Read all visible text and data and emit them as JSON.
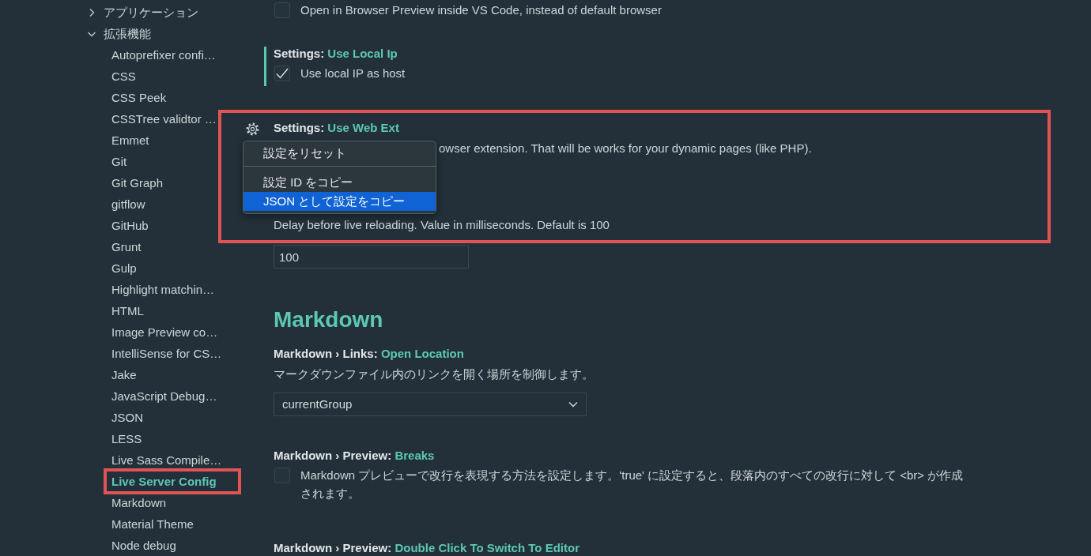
{
  "sidebar": {
    "items": [
      {
        "label": "アプリケーション",
        "expanded": false
      },
      {
        "label": "拡張機能",
        "expanded": true,
        "children": [
          {
            "label": "Autoprefixer confi…",
            "selected": false,
            "highlighted": false
          },
          {
            "label": "CSS",
            "selected": false,
            "highlighted": false
          },
          {
            "label": "CSS Peek",
            "selected": false,
            "highlighted": false
          },
          {
            "label": "CSSTree validtor …",
            "selected": false,
            "highlighted": false
          },
          {
            "label": "Emmet",
            "selected": false,
            "highlighted": false
          },
          {
            "label": "Git",
            "selected": false,
            "highlighted": false
          },
          {
            "label": "Git Graph",
            "selected": false,
            "highlighted": false
          },
          {
            "label": "gitflow",
            "selected": false,
            "highlighted": false
          },
          {
            "label": "GitHub",
            "selected": false,
            "highlighted": false
          },
          {
            "label": "Grunt",
            "selected": false,
            "highlighted": false
          },
          {
            "label": "Gulp",
            "selected": false,
            "highlighted": false
          },
          {
            "label": "Highlight matchin…",
            "selected": false,
            "highlighted": false
          },
          {
            "label": "HTML",
            "selected": false,
            "highlighted": false
          },
          {
            "label": "Image Preview co…",
            "selected": false,
            "highlighted": false
          },
          {
            "label": "IntelliSense for CS…",
            "selected": false,
            "highlighted": false
          },
          {
            "label": "Jake",
            "selected": false,
            "highlighted": false
          },
          {
            "label": "JavaScript Debug…",
            "selected": false,
            "highlighted": false
          },
          {
            "label": "JSON",
            "selected": false,
            "highlighted": false
          },
          {
            "label": "LESS",
            "selected": false,
            "highlighted": false
          },
          {
            "label": "Live Sass Compile…",
            "selected": false,
            "highlighted": false
          },
          {
            "label": "Live Server Config",
            "selected": true,
            "highlighted": true
          },
          {
            "label": "Markdown",
            "selected": false,
            "highlighted": false
          },
          {
            "label": "Material Theme",
            "selected": false,
            "highlighted": false
          },
          {
            "label": "Node debug",
            "selected": false,
            "highlighted": false
          }
        ]
      }
    ]
  },
  "sections": [
    {
      "settings": [
        {
          "control": {
            "kind": "checkbox",
            "checked": false,
            "label": "Open in Browser Preview inside VS Code, instead of default browser"
          }
        },
        {
          "category": "Settings:",
          "name": "Use Local Ip",
          "modified": true,
          "control": {
            "kind": "checkbox",
            "checked": true,
            "label": "Use local IP as host"
          }
        },
        {
          "category": "Settings:",
          "name": "Use Web Ext",
          "hovered": true,
          "highlighted": true,
          "description": "owser extension. That will be works for your dynamic pages (like PHP).",
          "context_menu": {
            "items": [
              {
                "kind": "item",
                "label": "設定をリセット",
                "selected": false
              },
              {
                "kind": "separator"
              },
              {
                "kind": "item",
                "label": "設定 ID をコピー",
                "selected": false
              },
              {
                "kind": "item",
                "label": "JSON として設定をコピー",
                "selected": true
              }
            ]
          }
        },
        {
          "highlighted": true,
          "description": "Delay before live reloading. Value in milliseconds. Default is 100",
          "control": {
            "kind": "number",
            "value": "100"
          }
        }
      ]
    },
    {
      "heading": "Markdown",
      "settings": [
        {
          "category": "Markdown › Links:",
          "name": "Open Location",
          "description": "マークダウンファイル内のリンクを開く場所を制御します。",
          "control": {
            "kind": "select",
            "value": "currentGroup"
          }
        },
        {
          "category": "Markdown › Preview:",
          "name": "Breaks",
          "control": {
            "kind": "checkbox",
            "checked": false,
            "label": "Markdown プレビューで改行を表現する方法を設定します。'true' に設定すると、段落内のすべての改行に対して <br> が作成されます。"
          }
        },
        {
          "category": "Markdown › Preview:",
          "name": "Double Click To Switch To Editor"
        }
      ]
    }
  ]
}
